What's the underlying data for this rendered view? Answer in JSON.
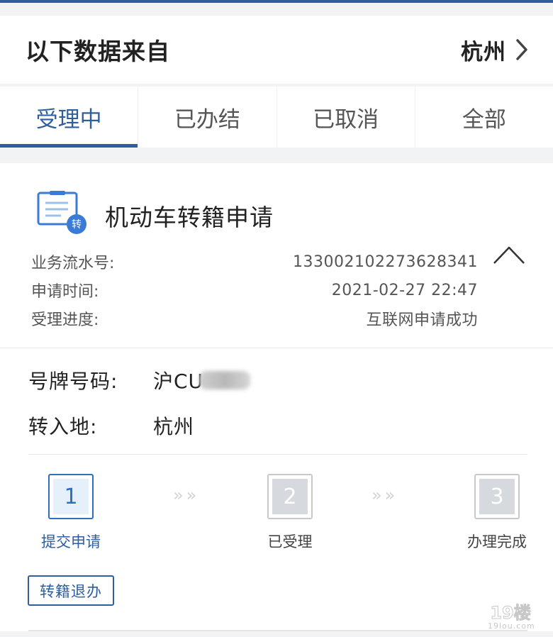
{
  "region": {
    "title": "以下数据来自",
    "city": "杭州"
  },
  "tabs": [
    {
      "label": "受理中",
      "active": true
    },
    {
      "label": "已办结",
      "active": false
    },
    {
      "label": "已取消",
      "active": false
    },
    {
      "label": "全部",
      "active": false
    }
  ],
  "application": {
    "icon_badge": "转",
    "title": "机动车转籍申请",
    "info": [
      {
        "label": "业务流水号:",
        "value": "133002102273628341"
      },
      {
        "label": "申请时间:",
        "value": "2021-02-27 22:47"
      },
      {
        "label": "受理进度:",
        "value": "互联网申请成功"
      }
    ],
    "plate": {
      "label": "号牌号码:",
      "value": "沪CU"
    },
    "destination": {
      "label": "转入地:",
      "value": "杭州"
    },
    "steps": [
      {
        "number": "1",
        "label": "提交申请",
        "active": true
      },
      {
        "number": "2",
        "label": "已受理",
        "active": false
      },
      {
        "number": "3",
        "label": "办理完成",
        "active": false
      }
    ],
    "step_separator": "»»",
    "cancel_label": "转籍退办"
  },
  "watermark": {
    "logo": "19楼",
    "text": "19lou.com"
  },
  "colors": {
    "accent": "#2e5e9e",
    "step_active_border": "#2e6fbe",
    "step_inactive": "#d6d9de",
    "background": "#f2f3f5"
  }
}
